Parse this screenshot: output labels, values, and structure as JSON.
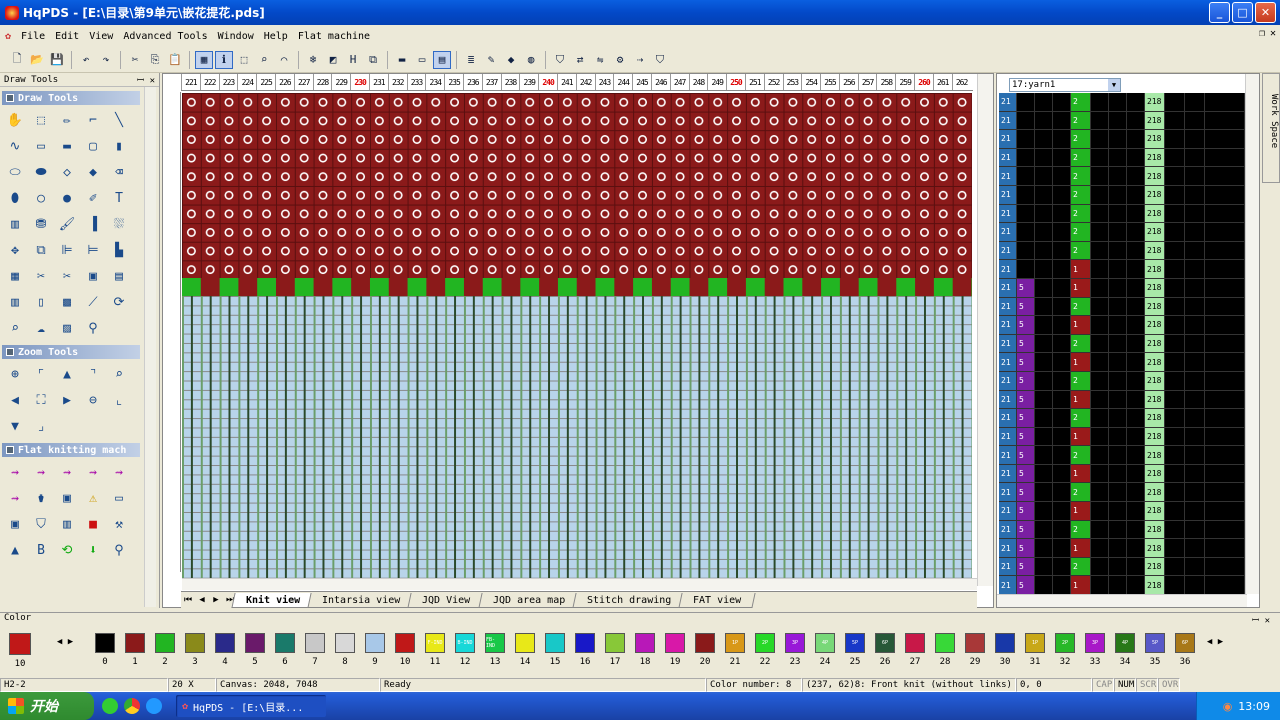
{
  "window": {
    "title": "HqPDS - [E:\\目录\\第9单元\\嵌花提花.pds]"
  },
  "menu": [
    "File",
    "Edit",
    "View",
    "Advanced Tools",
    "Window",
    "Help",
    "Flat machine"
  ],
  "left_panel": {
    "title": "Draw Tools",
    "sections": {
      "draw": "Draw Tools",
      "zoom": "Zoom Tools",
      "flat": "Flat knitting mach"
    }
  },
  "ruler": {
    "labels": [
      "221",
      "222",
      "223",
      "224",
      "225",
      "226",
      "227",
      "228",
      "229",
      "230",
      "231",
      "232",
      "233",
      "234",
      "235",
      "236",
      "237",
      "238",
      "239",
      "240",
      "241",
      "242",
      "243",
      "244",
      "245",
      "246",
      "247",
      "248",
      "249",
      "250",
      "251",
      "252",
      "253",
      "254",
      "255",
      "256",
      "257",
      "258",
      "259",
      "260",
      "261",
      "262"
    ],
    "highlighted": [
      "230",
      "240",
      "250",
      "260"
    ]
  },
  "tabs": [
    "Knit view",
    "Intarsia view",
    "JQD View",
    "JQD area map",
    "Stitch drawing",
    "FAT view"
  ],
  "right_panel": {
    "yarn_select": "17:yarn1",
    "work_space": "Work Space"
  },
  "color_panel": {
    "title": "Color",
    "selected": "10",
    "swatches": [
      {
        "num": "0",
        "color": "#000000",
        "label": ""
      },
      {
        "num": "1",
        "color": "#8b1a1a",
        "label": ""
      },
      {
        "num": "2",
        "color": "#22b522",
        "label": ""
      },
      {
        "num": "3",
        "color": "#8a8a1a",
        "label": ""
      },
      {
        "num": "4",
        "color": "#2a2a8a",
        "label": ""
      },
      {
        "num": "5",
        "color": "#6a1a6a",
        "label": ""
      },
      {
        "num": "6",
        "color": "#1a7a6a",
        "label": ""
      },
      {
        "num": "7",
        "color": "#c8c8c8",
        "label": ""
      },
      {
        "num": "8",
        "color": "#d8d8d8",
        "label": ""
      },
      {
        "num": "9",
        "color": "#a8c8e8",
        "label": ""
      },
      {
        "num": "10",
        "color": "#c01818",
        "label": ""
      },
      {
        "num": "11",
        "color": "#e8e818",
        "label": "F-IND"
      },
      {
        "num": "12",
        "color": "#18d8d8",
        "label": "B-IND"
      },
      {
        "num": "13",
        "color": "#18c848",
        "label": "FB-IND"
      },
      {
        "num": "14",
        "color": "#e8e818",
        "label": ""
      },
      {
        "num": "15",
        "color": "#18c8c8",
        "label": ""
      },
      {
        "num": "16",
        "color": "#1818c8",
        "label": ""
      },
      {
        "num": "17",
        "color": "#88c838",
        "label": ""
      },
      {
        "num": "18",
        "color": "#b818b8",
        "label": ""
      },
      {
        "num": "19",
        "color": "#d818a8",
        "label": ""
      },
      {
        "num": "20",
        "color": "#8a1a1a",
        "label": ""
      },
      {
        "num": "21",
        "color": "#d89818",
        "label": "1P"
      },
      {
        "num": "22",
        "color": "#28d828",
        "label": "2P"
      },
      {
        "num": "23",
        "color": "#9818d8",
        "label": "3P"
      },
      {
        "num": "24",
        "color": "#78d878",
        "label": "4P"
      },
      {
        "num": "25",
        "color": "#1838c8",
        "label": "5P"
      },
      {
        "num": "26",
        "color": "#285838",
        "label": "6P"
      },
      {
        "num": "27",
        "color": "#c81848",
        "label": ""
      },
      {
        "num": "28",
        "color": "#38d838",
        "label": ""
      },
      {
        "num": "29",
        "color": "#a83838",
        "label": ""
      },
      {
        "num": "30",
        "color": "#1838a8",
        "label": ""
      },
      {
        "num": "31",
        "color": "#c8a818",
        "label": "1P"
      },
      {
        "num": "32",
        "color": "#28b828",
        "label": "2P"
      },
      {
        "num": "33",
        "color": "#a818c8",
        "label": "3P"
      },
      {
        "num": "34",
        "color": "#287818",
        "label": "4P"
      },
      {
        "num": "35",
        "color": "#5858c8",
        "label": "5P"
      },
      {
        "num": "36",
        "color": "#a87818",
        "label": "6P"
      }
    ]
  },
  "status": {
    "item1": "H2-2",
    "zoom": "20 X",
    "canvas": "Canvas: 2048, 7048",
    "ready": "Ready",
    "color_number": "Color number: 8",
    "stitch": "(237, 62)8: Front knit (without links)",
    "pos": "0, 0",
    "cap": "CAP",
    "num": "NUM",
    "scrl": "SCRL",
    "ovr": "OVR"
  },
  "taskbar": {
    "start": "开始",
    "task": "HqPDS - [E:\\目录...",
    "clock": "13:09"
  }
}
